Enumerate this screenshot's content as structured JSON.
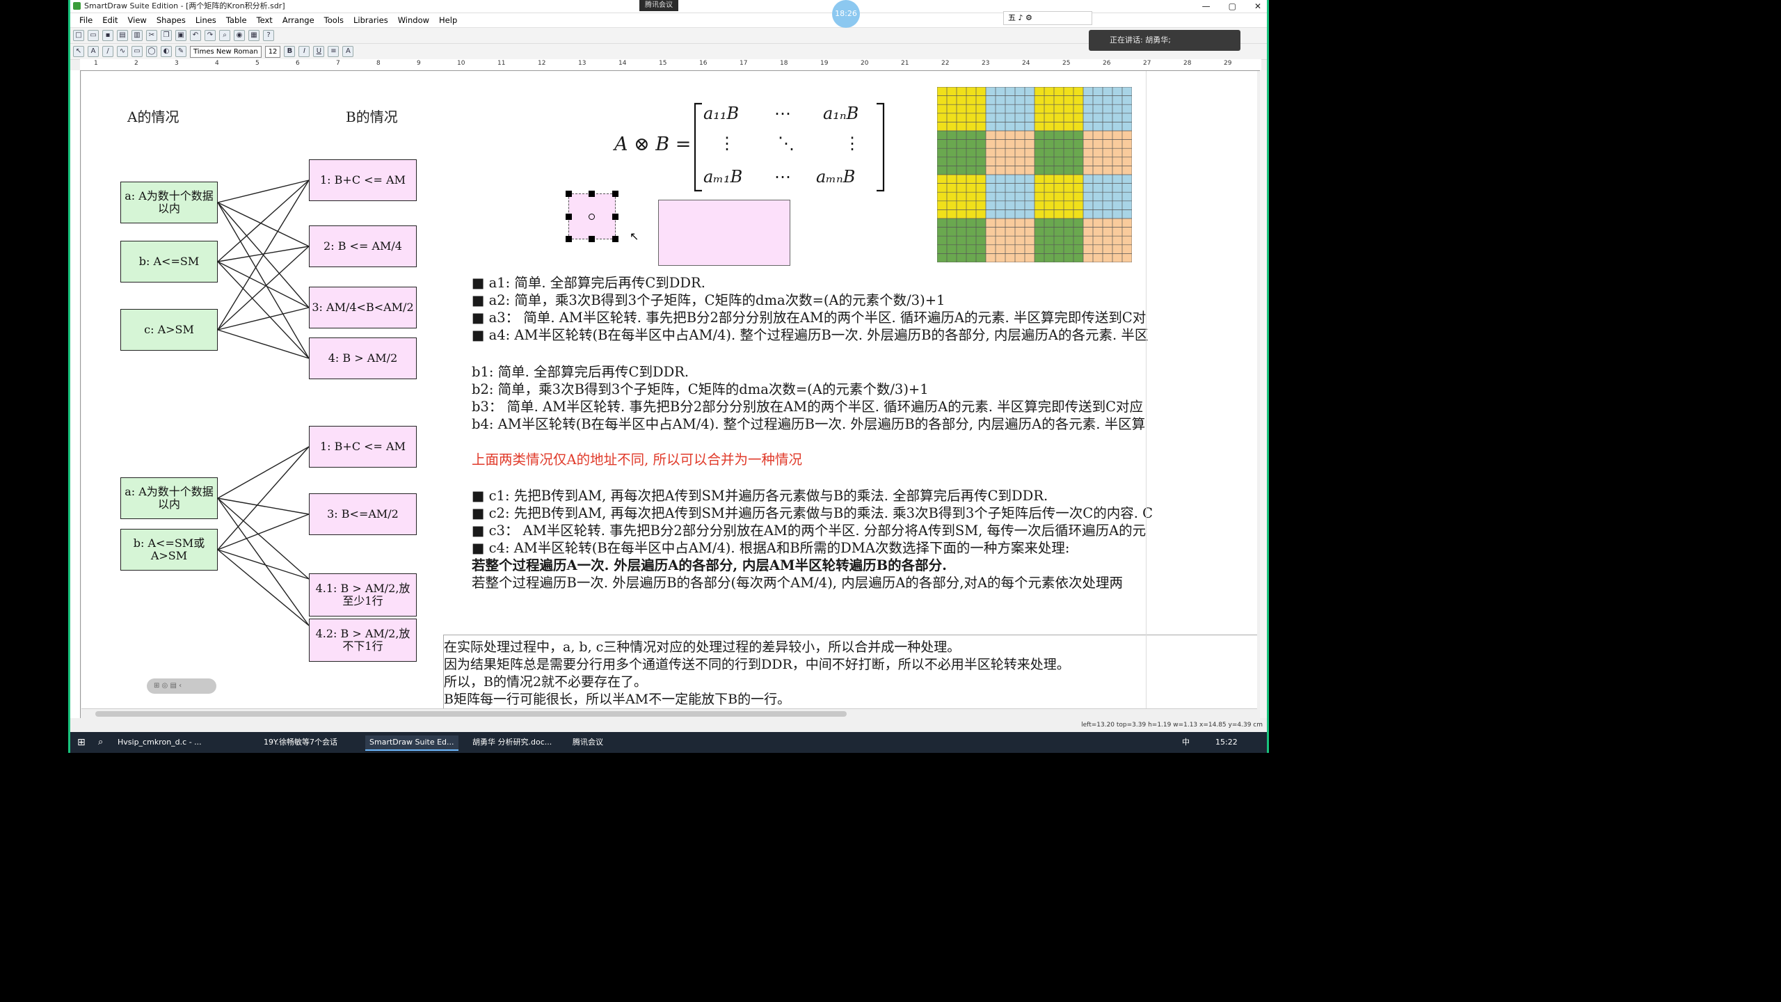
{
  "window": {
    "title": "SmartDraw Suite Edition - [两个矩阵的Kron积分析.sdr]",
    "meeting_tab": "腾讯会议",
    "controls": [
      "—",
      "▢",
      "✕"
    ]
  },
  "recording_timer": "18:26",
  "ime_toolbar": "五 ♪ ⚙",
  "speaking": "正在讲话: 胡勇华;",
  "menu": [
    "File",
    "Edit",
    "View",
    "Shapes",
    "Lines",
    "Table",
    "Text",
    "Arrange",
    "Tools",
    "Libraries",
    "Window",
    "Help"
  ],
  "toolbar": {
    "font": "Times New Roman",
    "size": "12",
    "bold": "B",
    "italic": "I",
    "underline": "U",
    "font_color": "A"
  },
  "ruler_ticks": [
    "1",
    "2",
    "3",
    "4",
    "5",
    "6",
    "7",
    "8",
    "9",
    "10",
    "11",
    "12",
    "13",
    "14",
    "15",
    "16",
    "17",
    "18",
    "19",
    "20",
    "21",
    "22",
    "23",
    "24",
    "25",
    "26",
    "27",
    "28",
    "29"
  ],
  "diagram": {
    "header_a": "A的情况",
    "header_b": "B的情况",
    "top_a": [
      "a: A为数十个数据以内",
      "b: A<=SM",
      "c: A>SM"
    ],
    "top_b": [
      "1: B+C <= AM",
      "2: B <= AM/4",
      "3: AM/4<B<AM/2",
      "4: B > AM/2"
    ],
    "bottom_a": [
      "a: A为数十个数据以内",
      "b: A<=SM或A>SM"
    ],
    "bottom_b": [
      "1: B+C <= AM",
      "3: B<=AM/2",
      "4.1: B > AM/2,放至少1行",
      "4.2: B > AM/2,放不下1行"
    ]
  },
  "formula": {
    "lhs": "A ⊗ B =",
    "r1": [
      "a₁₁B",
      "⋯",
      "a₁ₙB"
    ],
    "r2": [
      "⋮",
      "⋱",
      "⋮"
    ],
    "r3": [
      "aₘ₁B",
      "⋯",
      "aₘₙB"
    ]
  },
  "notes": {
    "a1": "■ a1: 简单. 全部算完后再传C到DDR.",
    "a2": "■ a2: 简单，乘3次B得到3个子矩阵，C矩阵的dma次数=(A的元素个数/3)+1",
    "a3": "■ a3： 简单. AM半区轮转. 事先把B分2部分分别放在AM的两个半区. 循环遍历A的元素. 半区算完即传送到C对",
    "a4": "■ a4: AM半区轮转(B在每半区中占AM/4). 整个过程遍历B一次. 外层遍历B的各部分, 内层遍历A的各元素. 半区",
    "b1": "b1: 简单. 全部算完后再传C到DDR.",
    "b2": "b2: 简单，乘3次B得到3个子矩阵，C矩阵的dma次数=(A的元素个数/3)+1",
    "b3": "b3： 简单. AM半区轮转. 事先把B分2部分分别放在AM的两个半区. 循环遍历A的元素. 半区算完即传送到C对应",
    "b4": "b4: AM半区轮转(B在每半区中占AM/4). 整个过程遍历B一次. 外层遍历B的各部分, 内层遍历A的各元素. 半区算",
    "red": "上面两类情况仅A的地址不同, 所以可以合并为一种情况",
    "c1": "■ c1: 先把B传到AM, 再每次把A传到SM并遍历各元素做与B的乘法. 全部算完后再传C到DDR.",
    "c2": "■ c2: 先把B传到AM, 再每次把A传到SM并遍历各元素做与B的乘法. 乘3次B得到3个子矩阵后传一次C的内容. C",
    "c3": "■ c3： AM半区轮转. 事先把B分2部分分别放在AM的两个半区. 分部分将A传到SM, 每传一次后循环遍历A的元",
    "c4": "■ c4: AM半区轮转(B在每半区中占AM/4). 根据A和B所需的DMA次数选择下面的一种方案来处理:",
    "c4a": "若整个过程遍历A一次. 外层遍历A的各部分, 内层AM半区轮转遍历B的各部分.",
    "c4b": "若整个过程遍历B一次. 外层遍历B的各部分(每次两个AM/4), 内层遍历A的各部分,对A的每个元素依次处理两"
  },
  "note_box": [
    "在实际处理过程中，a, b, c三种情况对应的处理过程的差异较小，所以合并成一种处理。",
    "因为结果矩阵总是需要分行用多个通道传送不同的行到DDR，中间不好打断，所以不必用半区轮转来处理。",
    "所以，B的情况2就不必要存在了。",
    "B矩阵每一行可能很长，所以半AM不一定能放下B的一行。"
  ],
  "grid_colors": [
    "#f0e01a",
    "#a8d4e6",
    "#6aa84f",
    "#f9cb9c"
  ],
  "status_text": "left=13.20 top=3.39 h=1.19 w=1.13   x=14.85 y=4.39 cm",
  "taskbar": {
    "tasks": [
      "Hvsip_cmkron_d.c - ...",
      "19Y.徐畅敏等7个会话",
      "SmartDraw Suite Ed...",
      "胡勇华 分析研究.doc...",
      "腾讯会议"
    ],
    "tray_lang": "中",
    "clock": "15:22"
  },
  "floating_toolbar": "⊞ ◎ ▤ ‹"
}
